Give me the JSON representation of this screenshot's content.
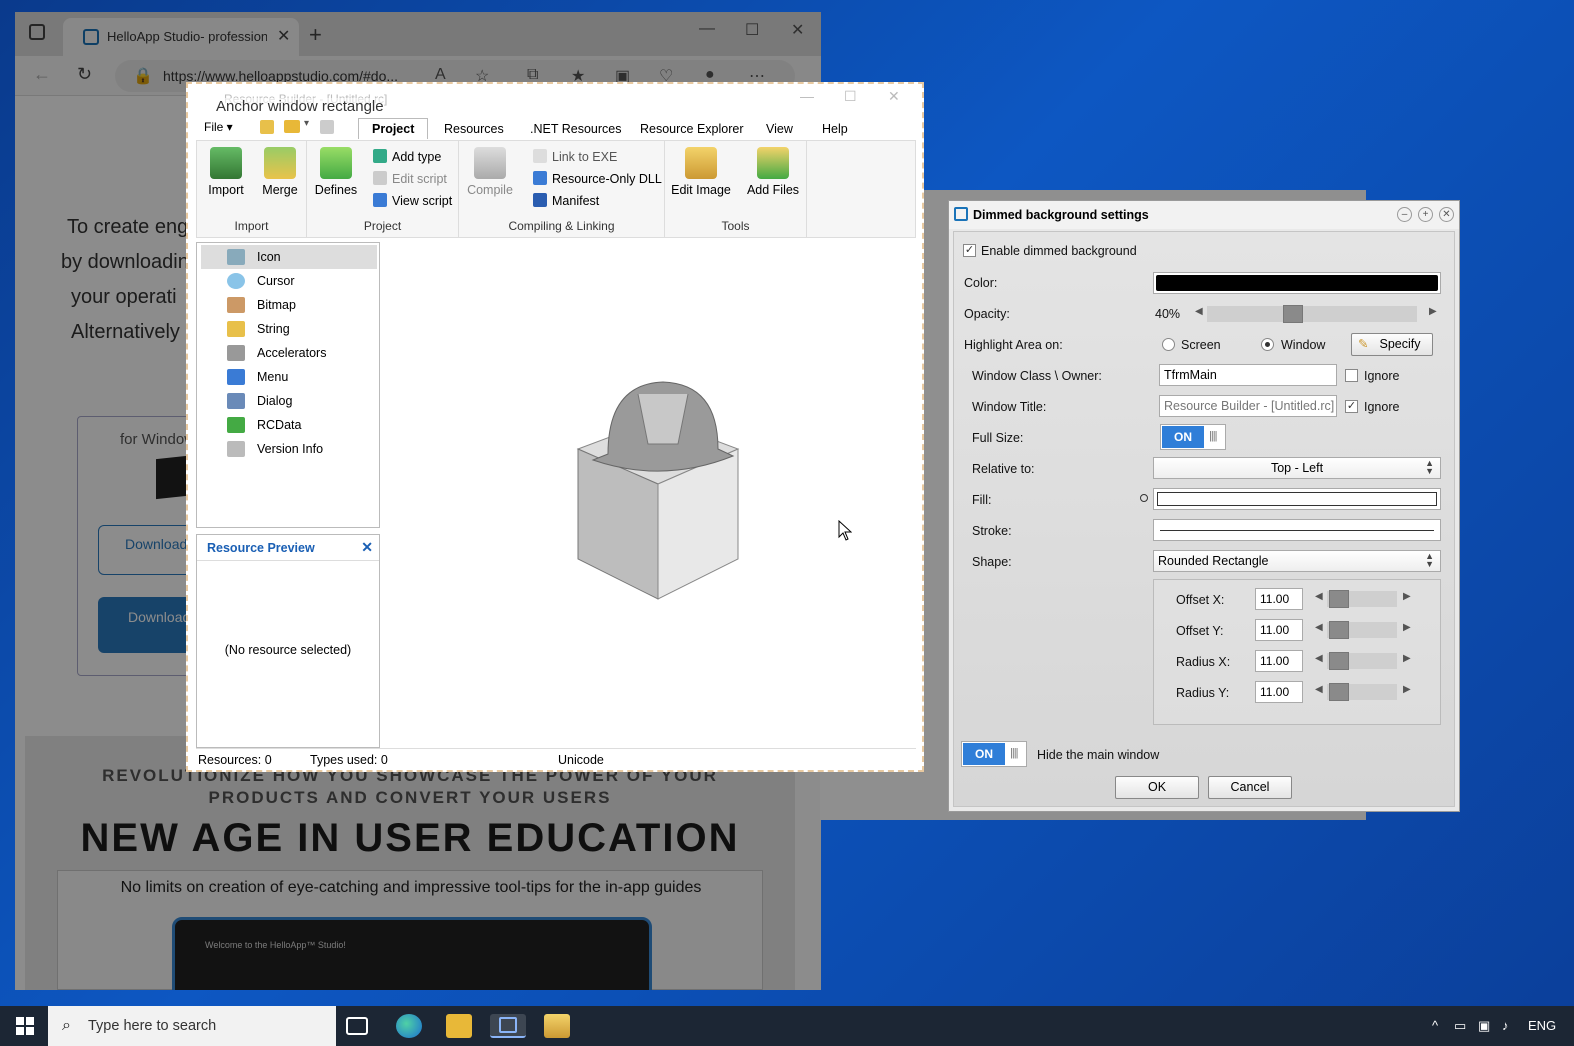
{
  "browser": {
    "tab_title": "HelloApp Studio- professional in",
    "url": "https://www.helloappstudio.com/#do...",
    "hero_lines": [
      "To create enga",
      "by downloadin",
      "your operati",
      "Alternatively"
    ],
    "card_label": "for Window",
    "download_1": "Download ON",
    "download_2": "Download STU",
    "band_sub_1": "REVOLUTIONIZE HOW YOU SHOWCASE THE POWER OF YOUR",
    "band_sub_2": "PRODUCTS AND CONVERT YOUR USERS",
    "band_title": "NEW AGE IN USER EDUCATION",
    "band_caption": "No limits on creation of eye-catching and impressive tool-tips for the in-app guides",
    "shot_caption": "Welcome to the HelloApp™ Studio!"
  },
  "rb": {
    "anchor_label": "Anchor window rectangle",
    "title": "Resource Builder - [Untitled.rc]",
    "file_menu": "File",
    "tabs": [
      "Project",
      "Resources",
      ".NET Resources",
      "Resource Explorer",
      "View",
      "Help"
    ],
    "groups": {
      "import": {
        "label": "Import",
        "buttons": [
          "Import",
          "Merge"
        ]
      },
      "project": {
        "label": "Project",
        "defines": "Defines",
        "add_type": "Add type",
        "edit_script": "Edit script",
        "view_script": "View script"
      },
      "compiling": {
        "label": "Compiling & Linking",
        "compile": "Compile",
        "link_exe": "Link to EXE",
        "resource_dll": "Resource-Only DLL",
        "manifest": "Manifest"
      },
      "tools": {
        "label": "Tools",
        "edit_image": "Edit Image",
        "add_files": "Add Files"
      }
    },
    "tree": [
      "Icon",
      "Cursor",
      "Bitmap",
      "String",
      "Accelerators",
      "Menu",
      "Dialog",
      "RCData",
      "Version Info"
    ],
    "preview_title": "Resource Preview",
    "preview_empty": "(No resource selected)",
    "status": {
      "resources": "Resources: 0",
      "types": "Types used: 0",
      "encoding": "Unicode"
    }
  },
  "dlg": {
    "title": "Dimmed background settings",
    "enable_label": "Enable dimmed background",
    "color_label": "Color:",
    "color_value": "#000000",
    "opacity_label": "Opacity:",
    "opacity_value": "40%",
    "opacity_fraction": 0.4,
    "highlight_label": "Highlight Area on:",
    "screen_option": "Screen",
    "window_option": "Window",
    "specify_button": "Specify",
    "window_class_label": "Window Class \\ Owner:",
    "window_class_value": "TfrmMain",
    "ignore_label": "Ignore",
    "window_title_label": "Window Title:",
    "window_title_value": "Resource Builder - [Untitled.rc]",
    "full_size_label": "Full Size:",
    "toggle_on": "ON",
    "relative_label": "Relative to:",
    "relative_value": "Top - Left",
    "fill_label": "Fill:",
    "stroke_label": "Stroke:",
    "shape_label": "Shape:",
    "shape_value": "Rounded Rectangle",
    "offset_x_label": "Offset X:",
    "offset_y_label": "Offset Y:",
    "radius_x_label": "Radius X:",
    "radius_y_label": "Radius Y:",
    "offset_x": "11.00",
    "offset_y": "11.00",
    "radius_x": "11.00",
    "radius_y": "11.00",
    "hide_label": "Hide the main window",
    "ok": "OK",
    "cancel": "Cancel"
  },
  "taskbar": {
    "search_placeholder": "Type here to search",
    "lang": "ENG"
  },
  "colors": {
    "accent": "#2f7ed8",
    "desktop": "#0d57c2",
    "taskbar": "#1c2634"
  }
}
